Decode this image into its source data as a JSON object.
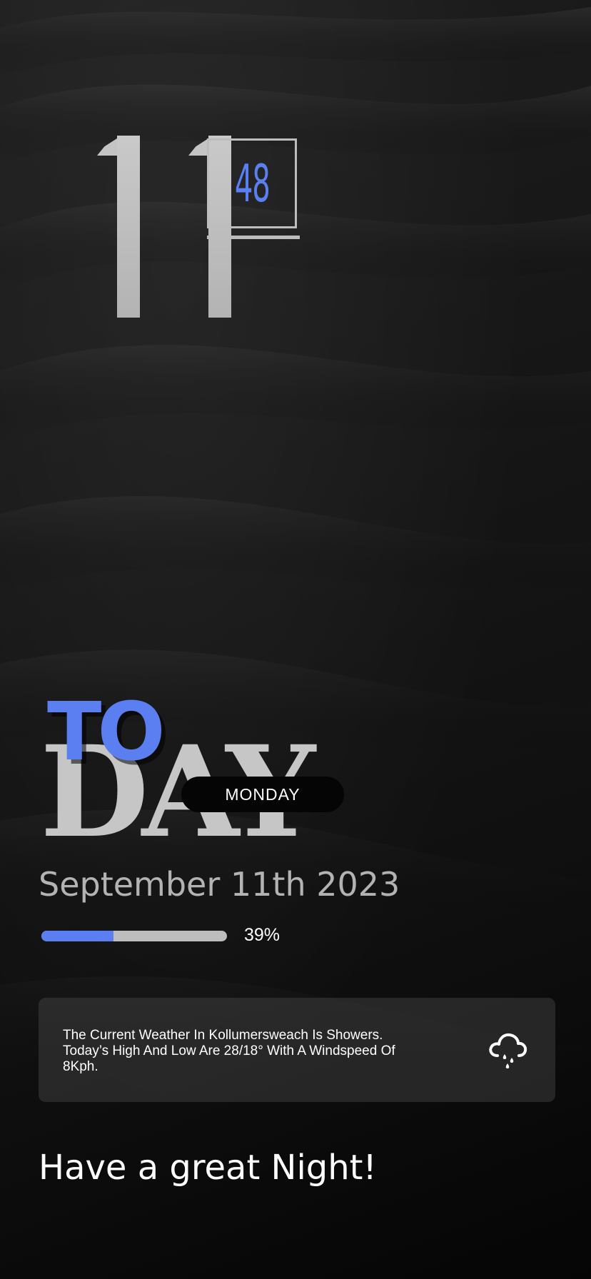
{
  "clock": {
    "hour": "11",
    "minute": "48"
  },
  "today": {
    "top_word": "TO",
    "bottom_word": "DAY",
    "weekday": "MONDAY",
    "date": "September 11th 2023"
  },
  "battery": {
    "percent_label": "39%",
    "level": 0.39
  },
  "weather": {
    "summary": "The Current Weather In Kollumersweach Is Showers. Today’s High And Low Are 28/18° With A Windspeed Of 8Kph.",
    "icon": "rain-cloud-icon"
  },
  "greeting": "Have a great Night!",
  "colors": {
    "accent": "#5b7ff0",
    "light_gray": "#c6c6c6",
    "background": "#141414"
  }
}
